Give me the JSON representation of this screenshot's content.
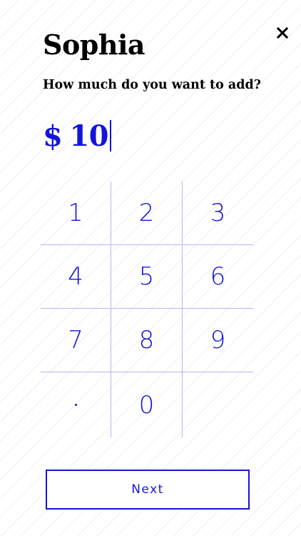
{
  "header": {
    "name": "Sophia",
    "question": "How much do you want to add?",
    "close_icon": "close-icon"
  },
  "amount": {
    "currency": "$",
    "value": "10"
  },
  "keypad": {
    "keys": [
      "1",
      "2",
      "3",
      "4",
      "5",
      "6",
      "7",
      "8",
      "9",
      "·",
      "0",
      ""
    ]
  },
  "footer": {
    "next_label": "Next"
  },
  "colors": {
    "accent": "#1414dc",
    "text": "#000000",
    "divider": "#b6b6f0",
    "background": "#ffffff"
  }
}
